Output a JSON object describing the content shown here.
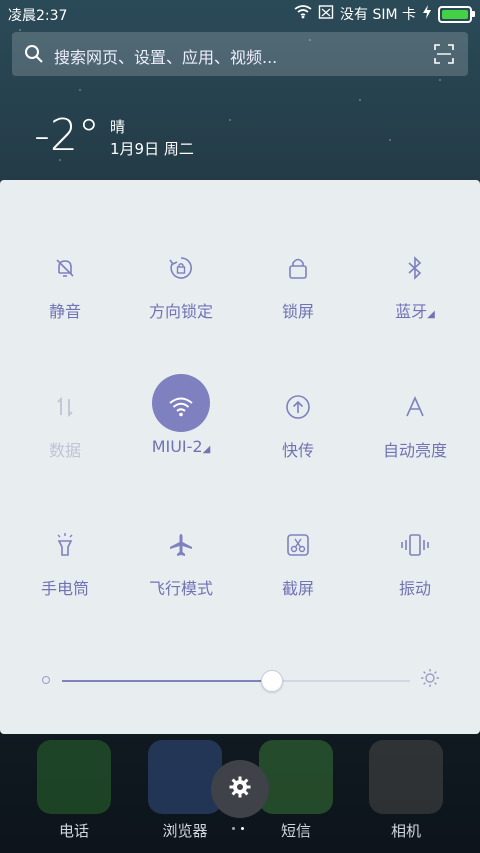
{
  "status_bar": {
    "time": "凌晨2:37",
    "sim": "没有 SIM 卡"
  },
  "search": {
    "placeholder": "搜索网页、设置、应用、视频..."
  },
  "weather": {
    "temperature": "-2°",
    "condition": "晴",
    "date": "1月9日 周二"
  },
  "quick_settings": {
    "tiles": [
      {
        "label": "静音",
        "icon": "bell-off-icon"
      },
      {
        "label": "方向锁定",
        "icon": "rotation-lock-icon"
      },
      {
        "label": "锁屏",
        "icon": "lock-icon"
      },
      {
        "label": "蓝牙",
        "icon": "bluetooth-icon"
      },
      {
        "label": "数据",
        "icon": "data-icon"
      },
      {
        "label": "MIUI-2",
        "icon": "wifi-icon"
      },
      {
        "label": "快传",
        "icon": "upload-icon"
      },
      {
        "label": "自动亮度",
        "icon": "auto-brightness-icon"
      },
      {
        "label": "手电筒",
        "icon": "flashlight-icon"
      },
      {
        "label": "飞行模式",
        "icon": "airplane-icon"
      },
      {
        "label": "截屏",
        "icon": "screenshot-icon"
      },
      {
        "label": "振动",
        "icon": "vibrate-icon"
      }
    ],
    "brightness": 0.6
  },
  "dock": {
    "apps": [
      {
        "label": "电话",
        "color": "#3a9a3a"
      },
      {
        "label": "浏览器",
        "color": "#4a76c6"
      },
      {
        "label": "短信",
        "color": "#4fa948"
      },
      {
        "label": "相机",
        "color": "#555555"
      }
    ]
  },
  "colors": {
    "accent": "#7f80bf",
    "panel": "#e8eef0"
  }
}
